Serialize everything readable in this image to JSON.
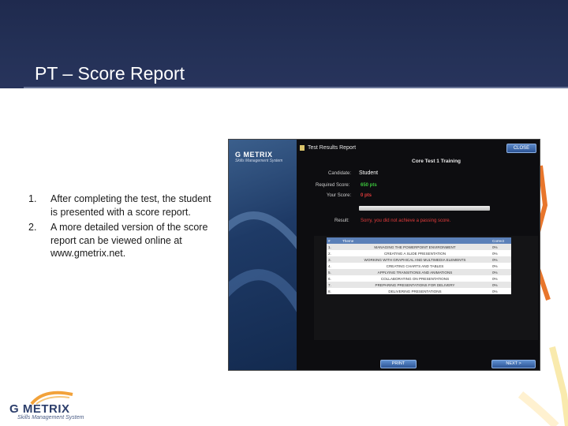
{
  "header": {
    "title": "PT – Score Report"
  },
  "steps": [
    {
      "num": "1.",
      "text": "After completing the test, the student is presented with a score report."
    },
    {
      "num": "2.",
      "text": "A more detailed version of the score report can be viewed online at www.gmetrix.net."
    }
  ],
  "screenshot": {
    "logo_text": "G METRIX",
    "logo_sub": "Skills Management System",
    "window_title": "Test Results Report",
    "close_label": "CLOSE",
    "test_name": "Core Test 1 Training",
    "candidate_label": "Candidate:",
    "candidate_value": "Student",
    "required_label": "Required Score:",
    "required_value": "650 pts",
    "your_score_label": "Your Score:",
    "your_score_value": "0 pts",
    "result_label": "Result:",
    "result_value": "Sorry, you did not achieve a passing score.",
    "table": {
      "headers": {
        "num": "#",
        "theme": "Theme",
        "correct": "Correct"
      },
      "rows": [
        {
          "num": "1.",
          "theme": "MANAGING THE POWERPOINT ENVIRONMENT",
          "correct": "0%"
        },
        {
          "num": "2.",
          "theme": "CREATING A SLIDE PRESENTATION",
          "correct": "0%"
        },
        {
          "num": "3.",
          "theme": "WORKING WITH GRAPHICAL AND MULTIMEDIA ELEMENTS",
          "correct": "0%"
        },
        {
          "num": "4.",
          "theme": "CREATING CHARTS AND TABLES",
          "correct": "0%"
        },
        {
          "num": "5.",
          "theme": "APPLYING TRANSITIONS AND ANIMATIONS",
          "correct": "0%"
        },
        {
          "num": "6.",
          "theme": "COLLABORATING ON PRESENTATIONS",
          "correct": "0%"
        },
        {
          "num": "7.",
          "theme": "PREPARING PRESENTATIONS FOR DELIVERY",
          "correct": "0%"
        },
        {
          "num": "8.",
          "theme": "DELIVERING PRESENTATIONS",
          "correct": "0%"
        }
      ]
    },
    "print_label": "PRINT",
    "next_label": "NEXT >"
  },
  "brand": {
    "main": "G METRIX",
    "sub": "Skills Management System"
  },
  "colors": {
    "header": "#243157",
    "accent_green": "#3cc43c",
    "accent_red": "#e23b3b",
    "table_header": "#5b80b8",
    "brand_swoosh": "#f2a23a"
  }
}
